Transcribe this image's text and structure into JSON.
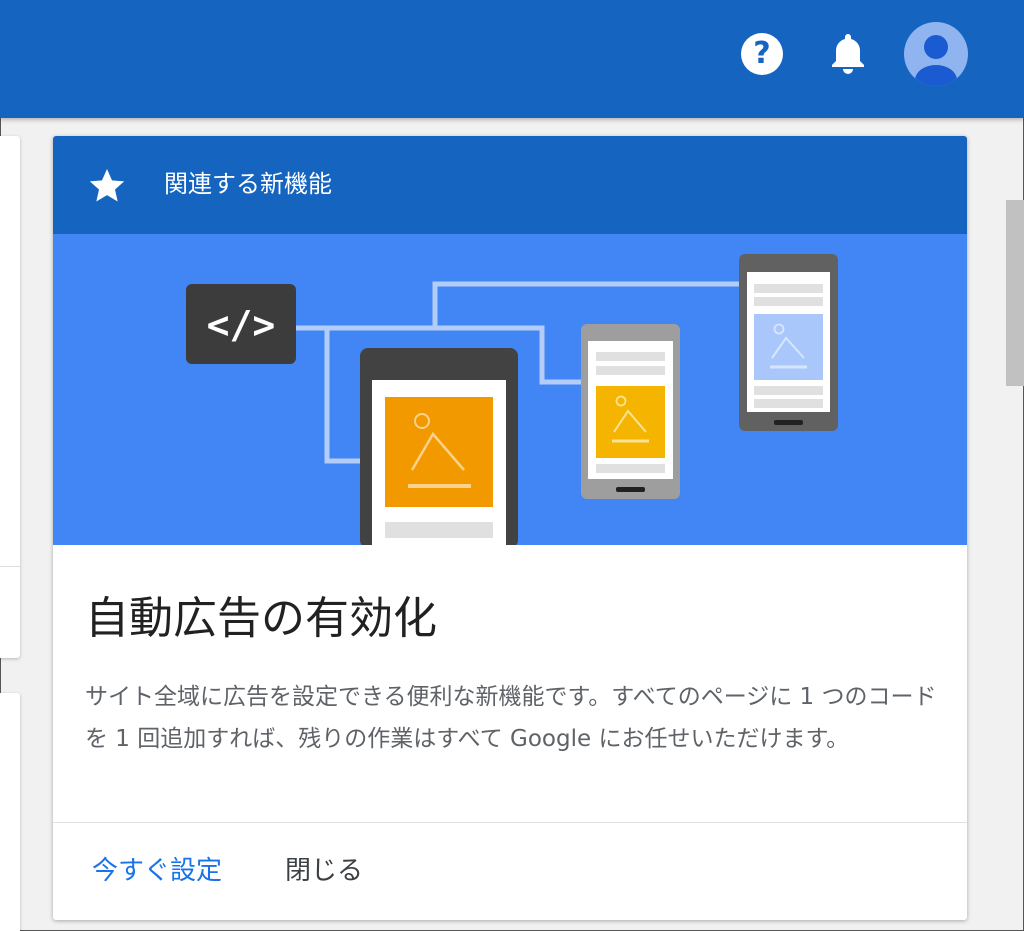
{
  "header": {
    "help_glyph": "?",
    "icons": [
      "help-icon",
      "bell-icon",
      "account-avatar-icon"
    ],
    "bar_color": "#1565c0"
  },
  "card": {
    "header_label": "関連する新機能",
    "header_icon": "star-icon",
    "title": "自動広告の有効化",
    "description": "サイト全域に広告を設定できる便利な新機能です。すべてのページに 1 つのコードを 1 回追加すれば、残りの作業はすべて Google にお任せいただけます。",
    "actions": {
      "primary": "今すぐ設定",
      "secondary": "閉じる"
    },
    "illustration": {
      "code_glyph": "</>",
      "background_color": "#4285f4",
      "accent_color": "#f29900"
    }
  }
}
